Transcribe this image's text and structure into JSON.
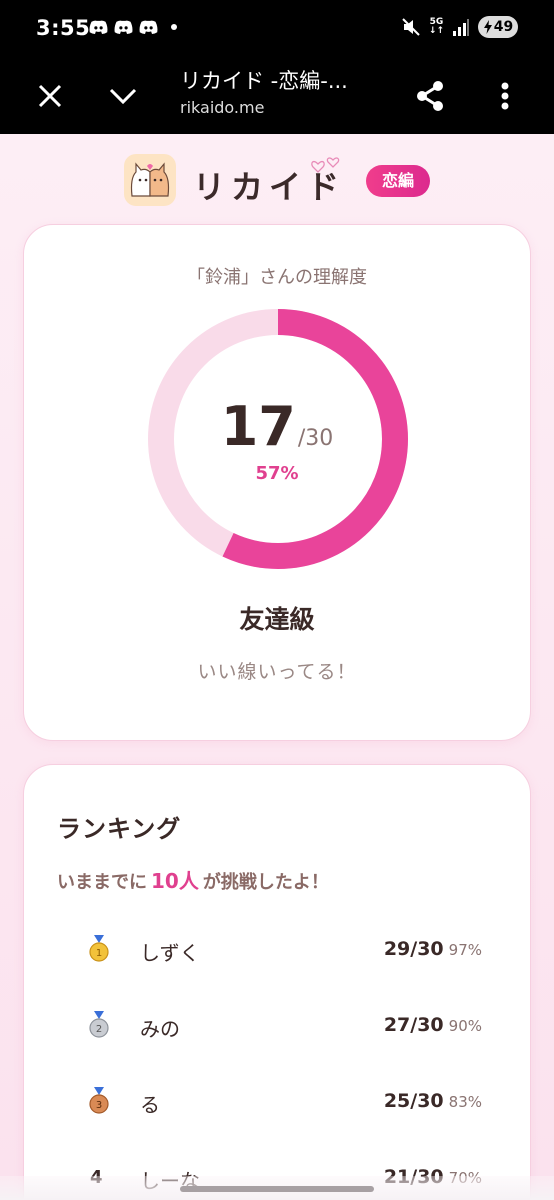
{
  "status_bar": {
    "time": "3:55",
    "network_type": "5G",
    "battery": "49",
    "notification_icons": [
      "discord-icon",
      "discord-icon",
      "discord-icon"
    ]
  },
  "browser": {
    "title": "リカイド -恋編-...",
    "url": "rikaido.me"
  },
  "app": {
    "name": "リカイド",
    "category": "恋編"
  },
  "score": {
    "heading": "「鈴浦」さんの理解度",
    "value": "17",
    "total": "/30",
    "percent": "57%",
    "fraction": 0.57,
    "rank_title": "友達級",
    "comment": "いい線いってる！"
  },
  "ranking": {
    "title": "ランキング",
    "challengers_prefix": "いままでに",
    "challengers_count": "10人",
    "challengers_suffix": "が挑戦したよ！",
    "rows": [
      {
        "medal": "gold",
        "name": "しずく",
        "score": "29/30",
        "percent": "97%"
      },
      {
        "medal": "silver",
        "name": "みの",
        "score": "27/30",
        "percent": "90%"
      },
      {
        "medal": "bronze",
        "name": "る",
        "score": "25/30",
        "percent": "83%"
      },
      {
        "rank": "4",
        "name": "しーな",
        "score": "21/30",
        "percent": "70%"
      }
    ]
  },
  "colors": {
    "accent": "#e9449a",
    "track": "#f9dbe9",
    "text": "#3a2927"
  }
}
